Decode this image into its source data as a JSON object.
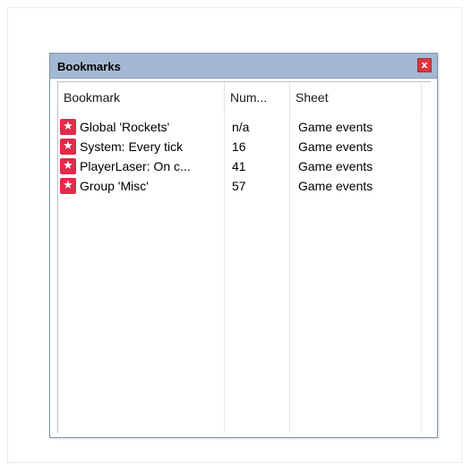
{
  "panel": {
    "title": "Bookmarks",
    "close_label": "x"
  },
  "columns": [
    "Bookmark",
    "Num...",
    "Sheet"
  ],
  "rows": [
    {
      "name": "Global 'Rockets'",
      "num": "n/a",
      "sheet": "Game events",
      "icon": "bookmark-star-icon"
    },
    {
      "name": "System: Every tick",
      "num": "16",
      "sheet": "Game events",
      "icon": "bookmark-star-icon"
    },
    {
      "name": "PlayerLaser: On c...",
      "num": "41",
      "sheet": "Game events",
      "icon": "bookmark-star-icon"
    },
    {
      "name": "Group 'Misc'",
      "num": "57",
      "sheet": "Game events",
      "icon": "bookmark-star-icon"
    }
  ],
  "colors": {
    "titlebar": "#a3b9d3",
    "close_button": "#d8383e",
    "star_icon": "#e22a4a"
  }
}
